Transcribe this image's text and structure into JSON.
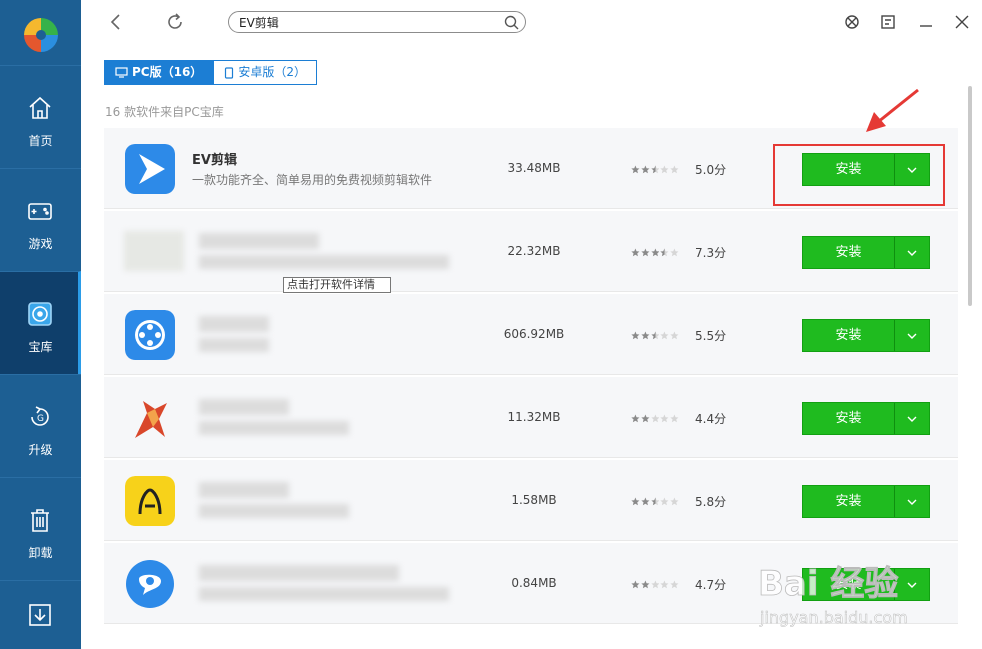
{
  "sidebar": {
    "items": [
      {
        "label": "首页",
        "icon": "home-icon"
      },
      {
        "label": "游戏",
        "icon": "gamepad-icon"
      },
      {
        "label": "宝库",
        "icon": "disc-icon",
        "active": true
      },
      {
        "label": "升级",
        "icon": "upgrade-icon"
      },
      {
        "label": "卸载",
        "icon": "trash-icon"
      },
      {
        "label": "",
        "icon": "download-icon"
      }
    ]
  },
  "search": {
    "value": "EV剪辑"
  },
  "tabs": [
    {
      "label": "PC版（16）",
      "icon": "monitor-icon",
      "active": true
    },
    {
      "label": "安卓版（2）",
      "icon": "phone-icon",
      "active": false
    }
  ],
  "result_count_text": "16 款软件来自PC宝库",
  "rows": [
    {
      "name": "EV剪辑",
      "desc": "一款功能齐全、简单易用的免费视频剪辑软件",
      "size": "33.48MB",
      "stars": 2.5,
      "score": "5.0分",
      "install": "安装",
      "icon": "ev-play-icon"
    },
    {
      "name": "",
      "desc": "",
      "size": "22.32MB",
      "stars": 3.5,
      "score": "7.3分",
      "install": "安装",
      "icon": "blurred-app-icon"
    },
    {
      "name": "",
      "desc": "",
      "size": "606.92MB",
      "stars": 2.5,
      "score": "5.5分",
      "install": "安装",
      "icon": "film-reel-icon"
    },
    {
      "name": "",
      "desc": "",
      "size": "11.32MB",
      "stars": 2,
      "score": "4.4分",
      "install": "安装",
      "icon": "red-figure-icon"
    },
    {
      "name": "",
      "desc": "",
      "size": "1.58MB",
      "stars": 2.5,
      "score": "5.8分",
      "install": "安装",
      "icon": "yellow-app-icon"
    },
    {
      "name": "",
      "desc": "",
      "size": "0.84MB",
      "stars": 2,
      "score": "4.7分",
      "install": "安装",
      "icon": "blue-chat-icon"
    }
  ],
  "tooltip": "点击打开软件详情",
  "watermark": {
    "brand": "Bai 经验",
    "url": "jingyan.baidu.com"
  },
  "colors": {
    "sidebar": "#1d5f93",
    "accent": "#1c7ed4",
    "install": "#1fbb1f",
    "highlight": "#e53935"
  }
}
